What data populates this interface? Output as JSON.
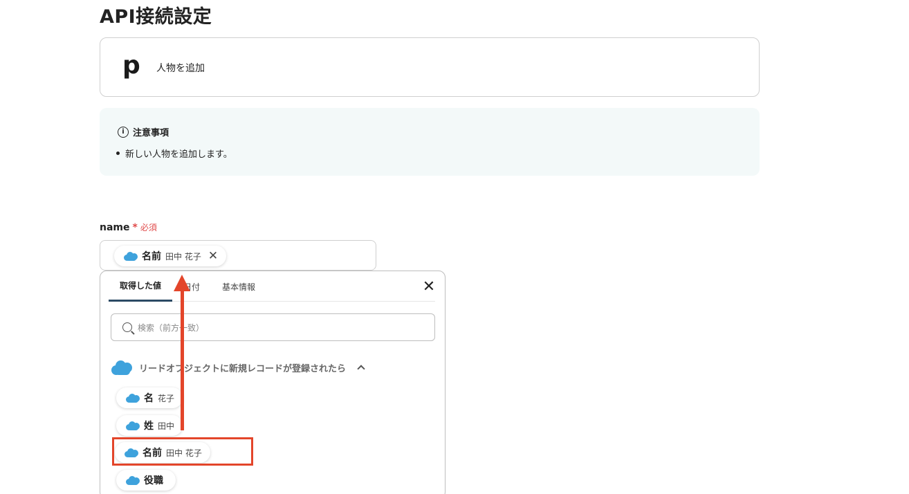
{
  "page": {
    "title": "API接続設定"
  },
  "app": {
    "logo": "p",
    "action": "人物を追加"
  },
  "notice": {
    "heading": "注意事項",
    "items": [
      "新しい人物を追加します。"
    ]
  },
  "field": {
    "label": "name",
    "required_mark": "*",
    "required_text": "必須",
    "chip": {
      "name": "名前",
      "value": "田中 花子"
    }
  },
  "dropdown": {
    "tabs": [
      {
        "label": "取得した値",
        "active": true
      },
      {
        "label": "日付",
        "active": false
      },
      {
        "label": "基本情報",
        "active": false
      }
    ],
    "search_placeholder": "検索（前方一致）",
    "group_title": "リードオブジェクトに新規レコードが登録されたら",
    "items": [
      {
        "name": "名",
        "value": "花子"
      },
      {
        "name": "姓",
        "value": "田中"
      },
      {
        "name": "名前",
        "value": "田中 花子"
      },
      {
        "name": "役職",
        "value": ""
      }
    ]
  },
  "colors": {
    "accent": "#2b4a64",
    "required": "#e04a4a",
    "annotation": "#e3452a",
    "salesforce": "#3ea2dc"
  }
}
